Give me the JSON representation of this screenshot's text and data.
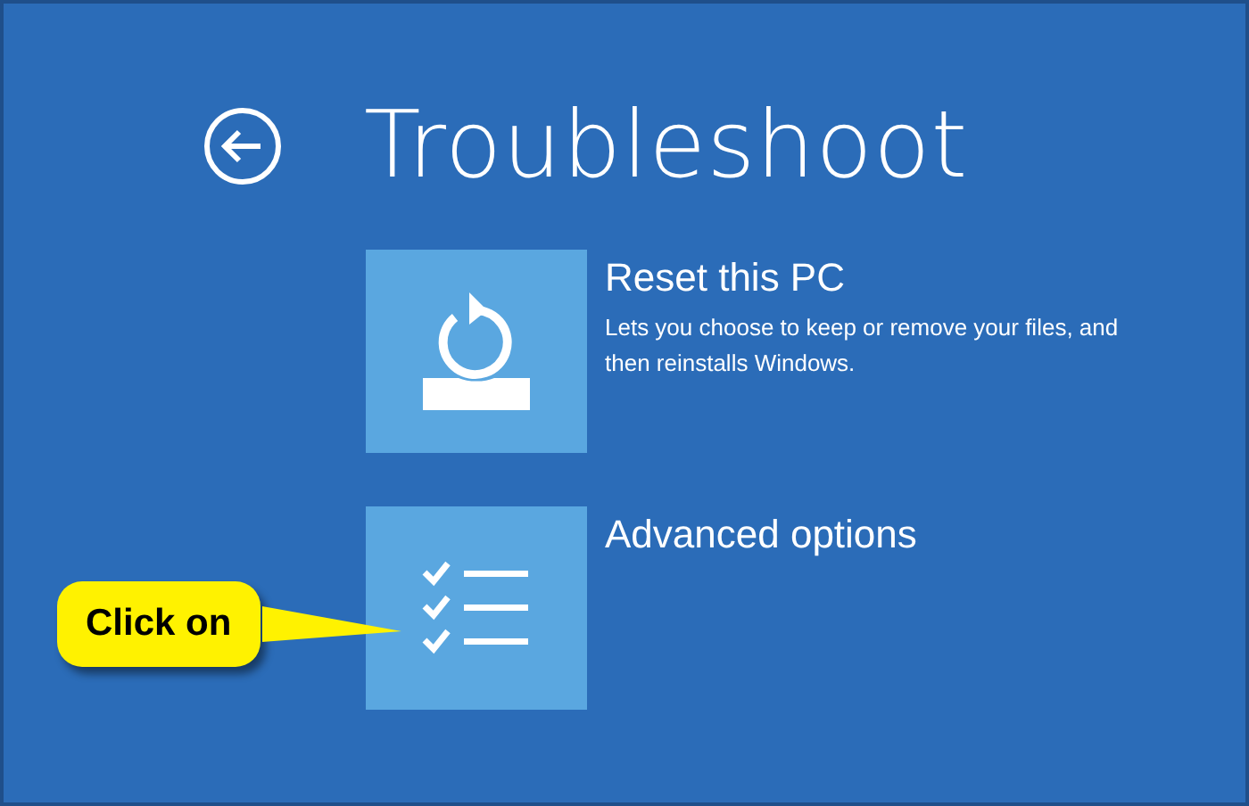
{
  "header": {
    "title": "Troubleshoot"
  },
  "options": [
    {
      "kind": "reset",
      "title": "Reset this PC",
      "description": "Lets you choose to keep or remove your files, and then reinstalls Windows."
    },
    {
      "kind": "advanced",
      "title": "Advanced options"
    }
  ],
  "callout": {
    "text": "Click on"
  }
}
